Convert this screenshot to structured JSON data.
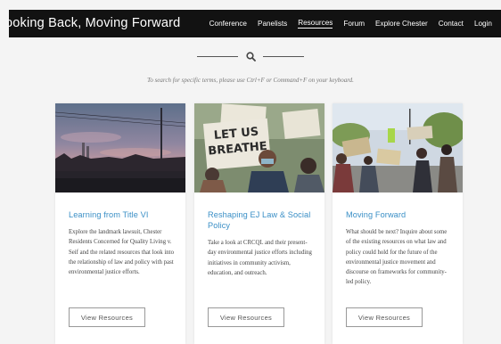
{
  "site": {
    "title": "ooking Back, Moving Forward"
  },
  "nav": {
    "items": [
      {
        "label": "Conference"
      },
      {
        "label": "Panelists"
      },
      {
        "label": "Resources",
        "active": true
      },
      {
        "label": "Forum"
      },
      {
        "label": "Explore Chester"
      },
      {
        "label": "Contact"
      },
      {
        "label": "Login"
      }
    ]
  },
  "search": {
    "icon": "search-icon",
    "hint": "To search for specific terms, please use Ctrl+F or Command+F on your keyboard."
  },
  "cards": [
    {
      "title": "Learning from Title VI",
      "description": "Explore the landmark lawsuit, Chester Residents Concerned for Quality Living v. Seif and the related resources that look into the relationship of law and policy with past environmental justice efforts.",
      "button": "View Resources",
      "sign_text": ""
    },
    {
      "title": "Reshaping EJ Law & Social Policy",
      "description": "Take a look at CRCQL and their present-day environmental justice efforts including initiatives in community activism, education, and outreach.",
      "button": "View Resources",
      "sign_text": "LET US BREATHE"
    },
    {
      "title": "Moving Forward",
      "description": "What should be next? Inquire about some of the existing resources on what law and policy could hold for the future of the environmental justice movement and discourse on frameworks for community-led policy.",
      "button": "View Resources",
      "sign_text": ""
    }
  ],
  "colors": {
    "nav_bg": "#121212",
    "accent": "#3a8fc6",
    "page_bg": "#f4f4f4"
  }
}
